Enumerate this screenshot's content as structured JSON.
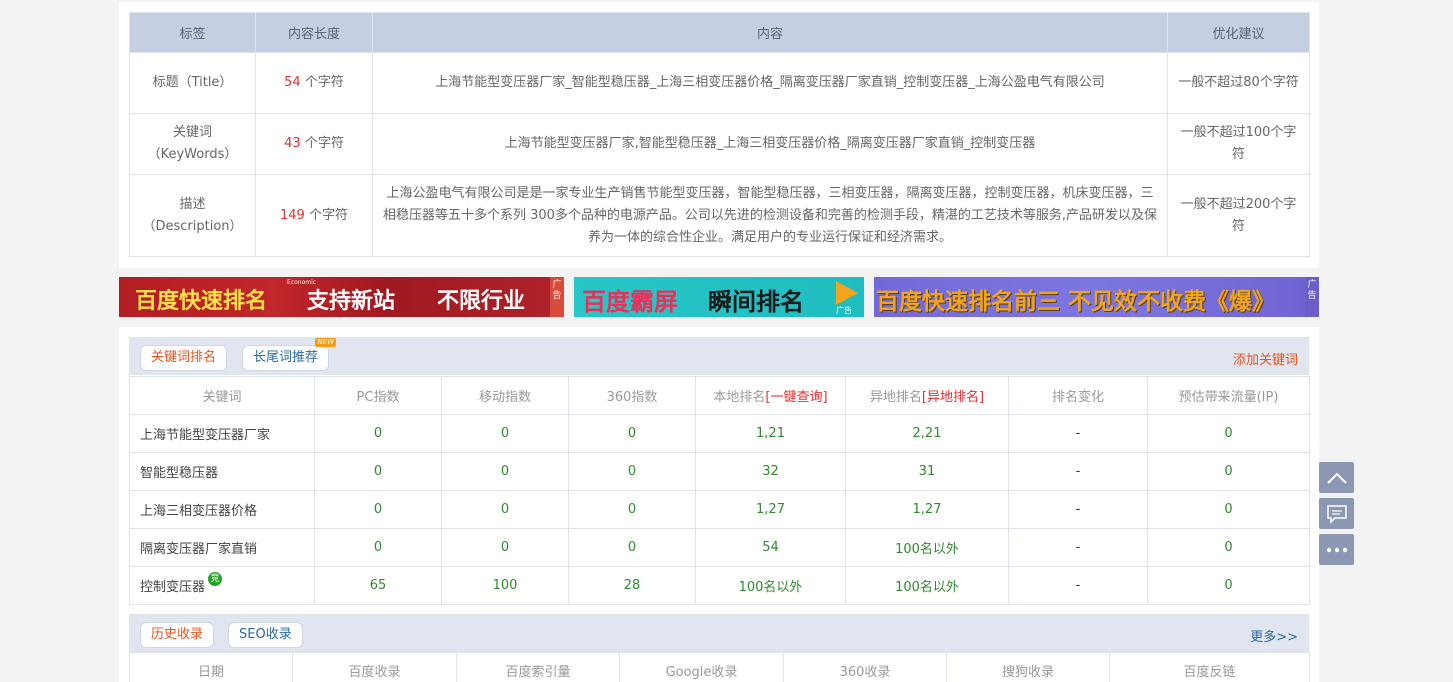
{
  "meta": {
    "headers": [
      "标签",
      "内容长度",
      "内容",
      "优化建议"
    ],
    "rows": [
      {
        "label": "标题（Title）",
        "length_num": "54",
        "length_unit": " 个字符",
        "content": "上海节能型变压器厂家_智能型稳压器_上海三相变压器价格_隔离变压器厂家直销_控制变压器_上海公盈电气有限公司",
        "advice": "一般不超过80个字符"
      },
      {
        "label": "关键词（KeyWords）",
        "length_num": "43",
        "length_unit": " 个字符",
        "content": "上海节能型变压器厂家,智能型稳压器_上海三相变压器价格_隔离变压器厂家直销_控制变压器",
        "advice": "一般不超过100个字符"
      },
      {
        "label": "描述（Description）",
        "length_num": "149",
        "length_unit": " 个字符",
        "content": "上海公盈电气有限公司是是一家专业生产销售节能型变压器，智能型稳压器，三相变压器，隔离变压器，控制变压器，机床变压器，三相稳压器等五十多个系列 300多个品种的电源产品。公司以先进的检测设备和完善的检测手段，精湛的工艺技术等服务,产品研发以及保养为一体的综合性企业。满足用户的专业运行保证和经济需求。",
        "advice": "一般不超过200个字符"
      }
    ]
  },
  "banners": [
    {
      "parts": [
        "百度快速排名",
        "支持新站",
        "不限行业"
      ],
      "tiny": "Economic",
      "ad": "广告"
    },
    {
      "parts": [
        "百度霸屏",
        "瞬间排名"
      ],
      "ad": "广告"
    },
    {
      "parts": [
        "百度快速排名前三 不见效不收费《爆》"
      ],
      "ad": "广告"
    }
  ],
  "rank": {
    "tabs": [
      "关键词排名",
      "长尾词推荐"
    ],
    "new_badge": "NEW",
    "add_link": "添加关键词",
    "headers": [
      "关键词",
      "PC指数",
      "移动指数",
      "360指数",
      "本地排名",
      "[一键查询]",
      "异地排名",
      "[异地排名]",
      "排名变化",
      "预估带来流量(IP)"
    ],
    "rows": [
      {
        "kw": "上海节能型变压器厂家",
        "pc": "0",
        "mobile": "0",
        "s360": "0",
        "local": "1,21",
        "remote": "2,21",
        "change": "-",
        "traffic": "0"
      },
      {
        "kw": "智能型稳压器",
        "pc": "0",
        "mobile": "0",
        "s360": "0",
        "local": "32",
        "remote": "31",
        "change": "-",
        "traffic": "0"
      },
      {
        "kw": "上海三相变压器价格",
        "pc": "0",
        "mobile": "0",
        "s360": "0",
        "local": "1,27",
        "remote": "1,27",
        "change": "-",
        "traffic": "0"
      },
      {
        "kw": "隔离变压器厂家直销",
        "pc": "0",
        "mobile": "0",
        "s360": "0",
        "local": "54",
        "remote": "100名以外",
        "change": "-",
        "traffic": "0"
      },
      {
        "kw": "控制变压器",
        "pc": "65",
        "mobile": "100",
        "s360": "28",
        "local": "100名以外",
        "remote": "100名以外",
        "change": "-",
        "traffic": "0",
        "badge": "竞"
      }
    ]
  },
  "history": {
    "tabs": [
      "历史收录",
      "SEO收录"
    ],
    "more_link": "更多>>",
    "headers": [
      "日期",
      "百度收录",
      "百度索引量",
      "Google收录",
      "360收录",
      "搜狗收录",
      "百度反链"
    ]
  },
  "colors": {
    "accent": "#e0561f",
    "link": "#2a6aa8",
    "header_bg": "#c5cee2",
    "side_button": "#8c97b4"
  },
  "side_buttons": [
    "chevron-up-icon",
    "feedback-icon",
    "more-dots-icon"
  ]
}
